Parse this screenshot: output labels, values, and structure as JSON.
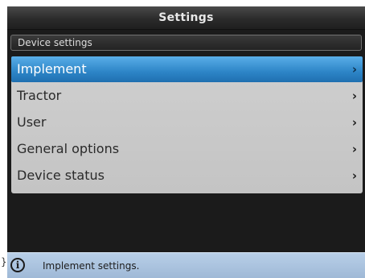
{
  "header": {
    "title": "Settings"
  },
  "section": {
    "label": "Device settings"
  },
  "menu": {
    "items": [
      {
        "label": "Implement",
        "selected": true
      },
      {
        "label": "Tractor",
        "selected": false
      },
      {
        "label": "User",
        "selected": false
      },
      {
        "label": "General options",
        "selected": false
      },
      {
        "label": "Device status",
        "selected": false
      }
    ],
    "chevron_glyph": "›"
  },
  "status": {
    "icon": "info-icon",
    "text": "Implement settings."
  },
  "colors": {
    "selected_accent": "#2d85c7",
    "status_bar": "#b8cfe8",
    "screen_background": "#1b1b1b"
  }
}
